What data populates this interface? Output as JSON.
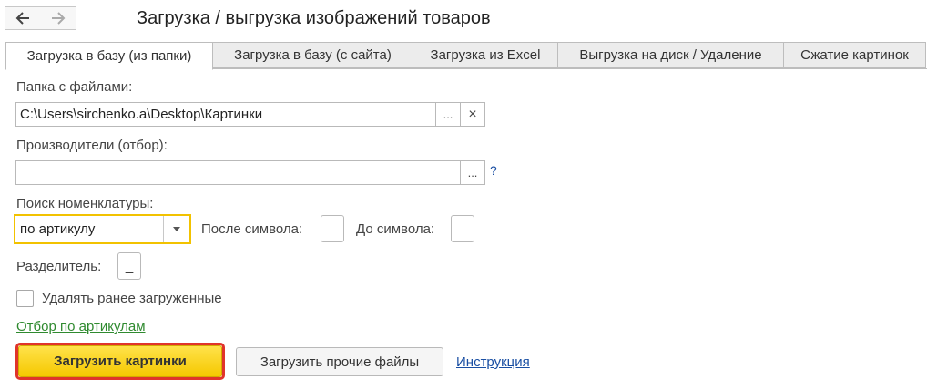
{
  "nav": {
    "back_icon": "arrow-left-icon",
    "forward_icon": "arrow-right-icon"
  },
  "window": {
    "title": "Загрузка / выгрузка изображений товаров"
  },
  "tabs": [
    {
      "label": "Загрузка в базу (из папки)",
      "active": true
    },
    {
      "label": "Загрузка в базу (с сайта)",
      "active": false
    },
    {
      "label": "Загрузка из Excel",
      "active": false
    },
    {
      "label": "Выгрузка на диск / Удаление",
      "active": false
    },
    {
      "label": "Сжатие картинок",
      "active": false
    }
  ],
  "folder": {
    "label": "Папка с файлами:",
    "value": "C:\\Users\\sirchenko.a\\Desktop\\Картинки",
    "browse_label": "...",
    "clear_label": "×"
  },
  "producers": {
    "label": "Производители (отбор):",
    "value": "",
    "browse_label": "...",
    "help_label": "?"
  },
  "search": {
    "label": "Поиск номенклатуры:",
    "selected": "по артикулу",
    "dropdown_icon": "triangle-down-icon",
    "after_label": "После символа:",
    "after_value": "",
    "before_label": "До символа:",
    "before_value": ""
  },
  "separator": {
    "label": "Разделитель:",
    "value": "_"
  },
  "delete_checkbox": {
    "label": "Удалять ранее загруженные",
    "checked": false
  },
  "filter_link": "Отбор по артикулам",
  "buttons": {
    "load_pictures": "Загрузить картинки",
    "load_other": "Загрузить прочие файлы",
    "instruction": "Инструкция"
  },
  "colors": {
    "accent_yellow": "#f5c800",
    "highlight_red": "#e0342b",
    "link_blue": "#1a4fa3",
    "link_green": "#2f8a2f",
    "focus_yellow": "#f2c200"
  }
}
